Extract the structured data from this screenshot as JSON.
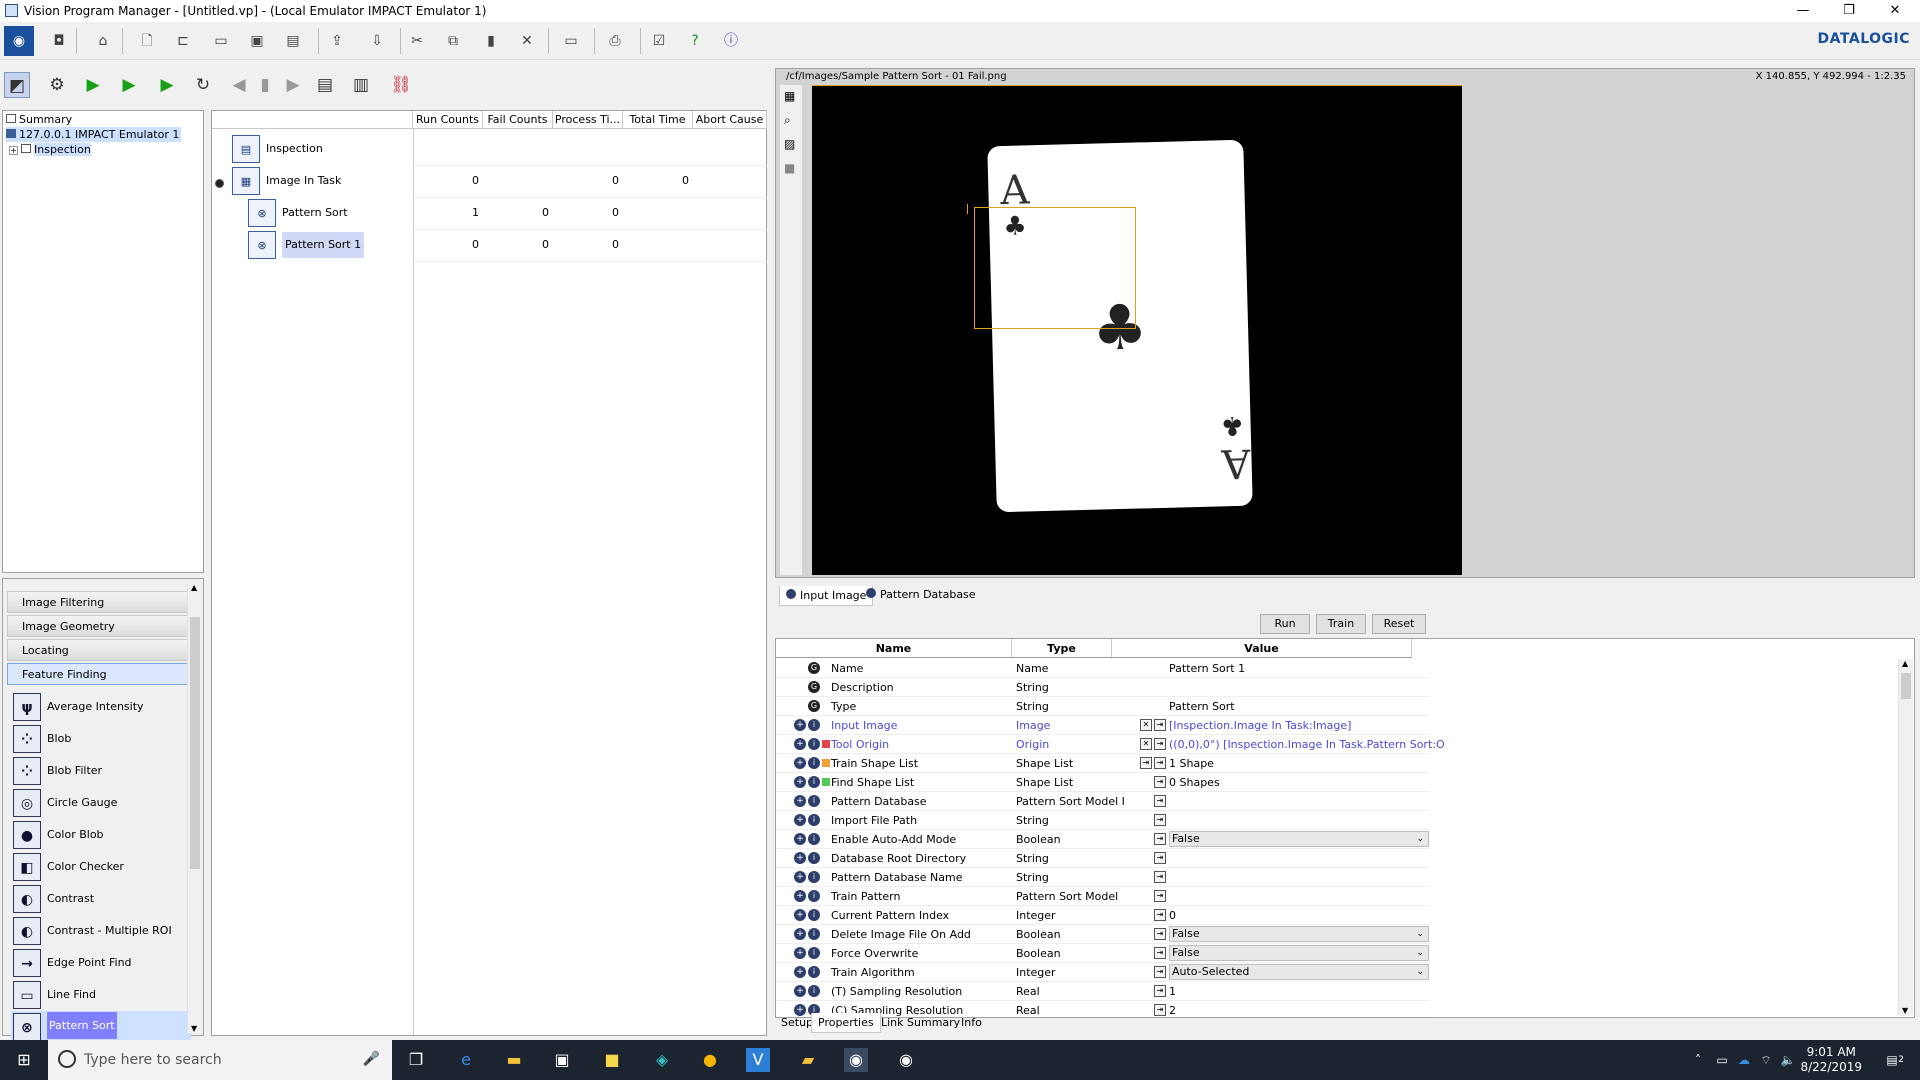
{
  "window": {
    "title": "Vision Program Manager - [Untitled.vp] - (Local Emulator IMPACT Emulator 1)",
    "minimize": "—",
    "maximize": "❐",
    "close": "✕"
  },
  "brand": "DATALOGIC",
  "tree": {
    "items": [
      "Summary",
      "127.0.0.1 IMPACT Emulator 1",
      "Inspection"
    ],
    "expander": "+"
  },
  "toolbox": {
    "categories": [
      "Image Filtering",
      "Image Geometry",
      "Locating",
      "Feature Finding"
    ],
    "tools": [
      "Average Intensity",
      "Blob",
      "Blob Filter",
      "Circle Gauge",
      "Color Blob",
      "Color Checker",
      "Contrast",
      "Contrast - Multiple ROI",
      "Edge Point Find",
      "Line Find",
      "Pattern Sort"
    ],
    "icons": [
      "ψ",
      "⁘",
      "⁘",
      "◎",
      "●",
      "◧",
      "◐",
      "◐",
      "→",
      "▭",
      "⊗"
    ]
  },
  "grid": {
    "columns": [
      "Run Counts",
      "Fail Counts",
      "Process Ti...",
      "Total Time",
      "Abort Cause"
    ],
    "nodes": [
      {
        "label": "Inspection",
        "icon": "▤",
        "cells": [
          "",
          "",
          "",
          "",
          ""
        ]
      },
      {
        "label": "Image In Task",
        "icon": "▦",
        "cells": [
          "0",
          "",
          "0",
          "0",
          ""
        ]
      },
      {
        "label": "Pattern Sort",
        "icon": "⊗",
        "cells": [
          "1",
          "0",
          "0",
          "",
          ""
        ]
      },
      {
        "label": "Pattern Sort 1",
        "icon": "⊗",
        "cells": [
          "0",
          "0",
          "0",
          "",
          ""
        ]
      }
    ]
  },
  "viewer": {
    "path": "/cf/Images/Sample Pattern Sort - 01 Fail.png",
    "coords": "X 140.855,  Y 492.994  -  1:2.35",
    "rank": "A",
    "suit": "♣"
  },
  "viewer_tabs": [
    "Input Image",
    "Pattern Database"
  ],
  "actions": [
    "Run",
    "Train",
    "Reset"
  ],
  "props": {
    "columns": [
      "Name",
      "Type",
      "Value"
    ],
    "rows": [
      {
        "name": "Name",
        "type": "Name",
        "value": "Pattern Sort 1"
      },
      {
        "name": "Description",
        "type": "String",
        "value": ""
      },
      {
        "name": "Type",
        "type": "String",
        "value": "Pattern Sort"
      },
      {
        "name": "Input Image",
        "type": "Image",
        "value": "[Inspection.Image In Task:Image]"
      },
      {
        "name": "Tool Origin",
        "type": "Origin",
        "value": "((0,0),0°) [Inspection.Image In Task.Pattern Sort:O"
      },
      {
        "name": "Train Shape List",
        "type": "Shape List",
        "value": "1 Shape"
      },
      {
        "name": "Find Shape List",
        "type": "Shape List",
        "value": "0 Shapes"
      },
      {
        "name": "Pattern Database",
        "type": "Pattern Sort Model I",
        "value": ""
      },
      {
        "name": "Import File Path",
        "type": "String",
        "value": ""
      },
      {
        "name": "Enable Auto-Add Mode",
        "type": "Boolean",
        "value": "False"
      },
      {
        "name": "Database Root Directory",
        "type": "String",
        "value": ""
      },
      {
        "name": "Pattern Database Name",
        "type": "String",
        "value": ""
      },
      {
        "name": "Train Pattern",
        "type": "Pattern Sort Model",
        "value": ""
      },
      {
        "name": "Current Pattern Index",
        "type": "Integer",
        "value": "0"
      },
      {
        "name": "Delete Image File On Add",
        "type": "Boolean",
        "value": "False"
      },
      {
        "name": "Force Overwrite",
        "type": "Boolean",
        "value": "False"
      },
      {
        "name": "Train Algorithm",
        "type": "Integer",
        "value": "Auto-Selected"
      },
      {
        "name": "(T) Sampling Resolution",
        "type": "Real",
        "value": "1"
      },
      {
        "name": "(C) Sampling Resolution",
        "type": "Real",
        "value": "2"
      }
    ]
  },
  "bottom_tabs": [
    "Setup",
    "Properties",
    "Link Summary",
    "Info"
  ],
  "taskbar": {
    "search_placeholder": "Type here to search",
    "time": "9:01 AM",
    "date": "8/22/2019",
    "notifications": "2"
  }
}
